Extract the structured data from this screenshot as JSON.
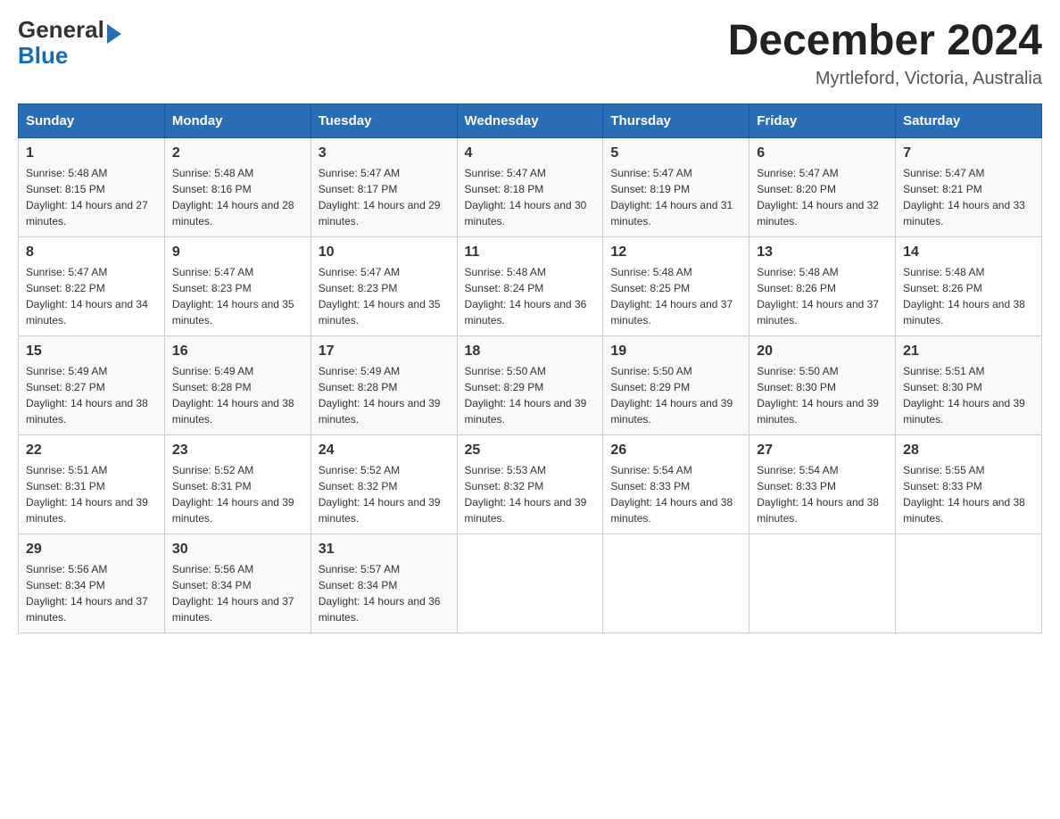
{
  "header": {
    "logo_text1": "General",
    "logo_text2": "Blue",
    "month_year": "December 2024",
    "location": "Myrtleford, Victoria, Australia"
  },
  "days_of_week": [
    "Sunday",
    "Monday",
    "Tuesday",
    "Wednesday",
    "Thursday",
    "Friday",
    "Saturday"
  ],
  "weeks": [
    [
      {
        "day": "1",
        "sunrise": "5:48 AM",
        "sunset": "8:15 PM",
        "daylight": "14 hours and 27 minutes."
      },
      {
        "day": "2",
        "sunrise": "5:48 AM",
        "sunset": "8:16 PM",
        "daylight": "14 hours and 28 minutes."
      },
      {
        "day": "3",
        "sunrise": "5:47 AM",
        "sunset": "8:17 PM",
        "daylight": "14 hours and 29 minutes."
      },
      {
        "day": "4",
        "sunrise": "5:47 AM",
        "sunset": "8:18 PM",
        "daylight": "14 hours and 30 minutes."
      },
      {
        "day": "5",
        "sunrise": "5:47 AM",
        "sunset": "8:19 PM",
        "daylight": "14 hours and 31 minutes."
      },
      {
        "day": "6",
        "sunrise": "5:47 AM",
        "sunset": "8:20 PM",
        "daylight": "14 hours and 32 minutes."
      },
      {
        "day": "7",
        "sunrise": "5:47 AM",
        "sunset": "8:21 PM",
        "daylight": "14 hours and 33 minutes."
      }
    ],
    [
      {
        "day": "8",
        "sunrise": "5:47 AM",
        "sunset": "8:22 PM",
        "daylight": "14 hours and 34 minutes."
      },
      {
        "day": "9",
        "sunrise": "5:47 AM",
        "sunset": "8:23 PM",
        "daylight": "14 hours and 35 minutes."
      },
      {
        "day": "10",
        "sunrise": "5:47 AM",
        "sunset": "8:23 PM",
        "daylight": "14 hours and 35 minutes."
      },
      {
        "day": "11",
        "sunrise": "5:48 AM",
        "sunset": "8:24 PM",
        "daylight": "14 hours and 36 minutes."
      },
      {
        "day": "12",
        "sunrise": "5:48 AM",
        "sunset": "8:25 PM",
        "daylight": "14 hours and 37 minutes."
      },
      {
        "day": "13",
        "sunrise": "5:48 AM",
        "sunset": "8:26 PM",
        "daylight": "14 hours and 37 minutes."
      },
      {
        "day": "14",
        "sunrise": "5:48 AM",
        "sunset": "8:26 PM",
        "daylight": "14 hours and 38 minutes."
      }
    ],
    [
      {
        "day": "15",
        "sunrise": "5:49 AM",
        "sunset": "8:27 PM",
        "daylight": "14 hours and 38 minutes."
      },
      {
        "day": "16",
        "sunrise": "5:49 AM",
        "sunset": "8:28 PM",
        "daylight": "14 hours and 38 minutes."
      },
      {
        "day": "17",
        "sunrise": "5:49 AM",
        "sunset": "8:28 PM",
        "daylight": "14 hours and 39 minutes."
      },
      {
        "day": "18",
        "sunrise": "5:50 AM",
        "sunset": "8:29 PM",
        "daylight": "14 hours and 39 minutes."
      },
      {
        "day": "19",
        "sunrise": "5:50 AM",
        "sunset": "8:29 PM",
        "daylight": "14 hours and 39 minutes."
      },
      {
        "day": "20",
        "sunrise": "5:50 AM",
        "sunset": "8:30 PM",
        "daylight": "14 hours and 39 minutes."
      },
      {
        "day": "21",
        "sunrise": "5:51 AM",
        "sunset": "8:30 PM",
        "daylight": "14 hours and 39 minutes."
      }
    ],
    [
      {
        "day": "22",
        "sunrise": "5:51 AM",
        "sunset": "8:31 PM",
        "daylight": "14 hours and 39 minutes."
      },
      {
        "day": "23",
        "sunrise": "5:52 AM",
        "sunset": "8:31 PM",
        "daylight": "14 hours and 39 minutes."
      },
      {
        "day": "24",
        "sunrise": "5:52 AM",
        "sunset": "8:32 PM",
        "daylight": "14 hours and 39 minutes."
      },
      {
        "day": "25",
        "sunrise": "5:53 AM",
        "sunset": "8:32 PM",
        "daylight": "14 hours and 39 minutes."
      },
      {
        "day": "26",
        "sunrise": "5:54 AM",
        "sunset": "8:33 PM",
        "daylight": "14 hours and 38 minutes."
      },
      {
        "day": "27",
        "sunrise": "5:54 AM",
        "sunset": "8:33 PM",
        "daylight": "14 hours and 38 minutes."
      },
      {
        "day": "28",
        "sunrise": "5:55 AM",
        "sunset": "8:33 PM",
        "daylight": "14 hours and 38 minutes."
      }
    ],
    [
      {
        "day": "29",
        "sunrise": "5:56 AM",
        "sunset": "8:34 PM",
        "daylight": "14 hours and 37 minutes."
      },
      {
        "day": "30",
        "sunrise": "5:56 AM",
        "sunset": "8:34 PM",
        "daylight": "14 hours and 37 minutes."
      },
      {
        "day": "31",
        "sunrise": "5:57 AM",
        "sunset": "8:34 PM",
        "daylight": "14 hours and 36 minutes."
      },
      null,
      null,
      null,
      null
    ]
  ]
}
